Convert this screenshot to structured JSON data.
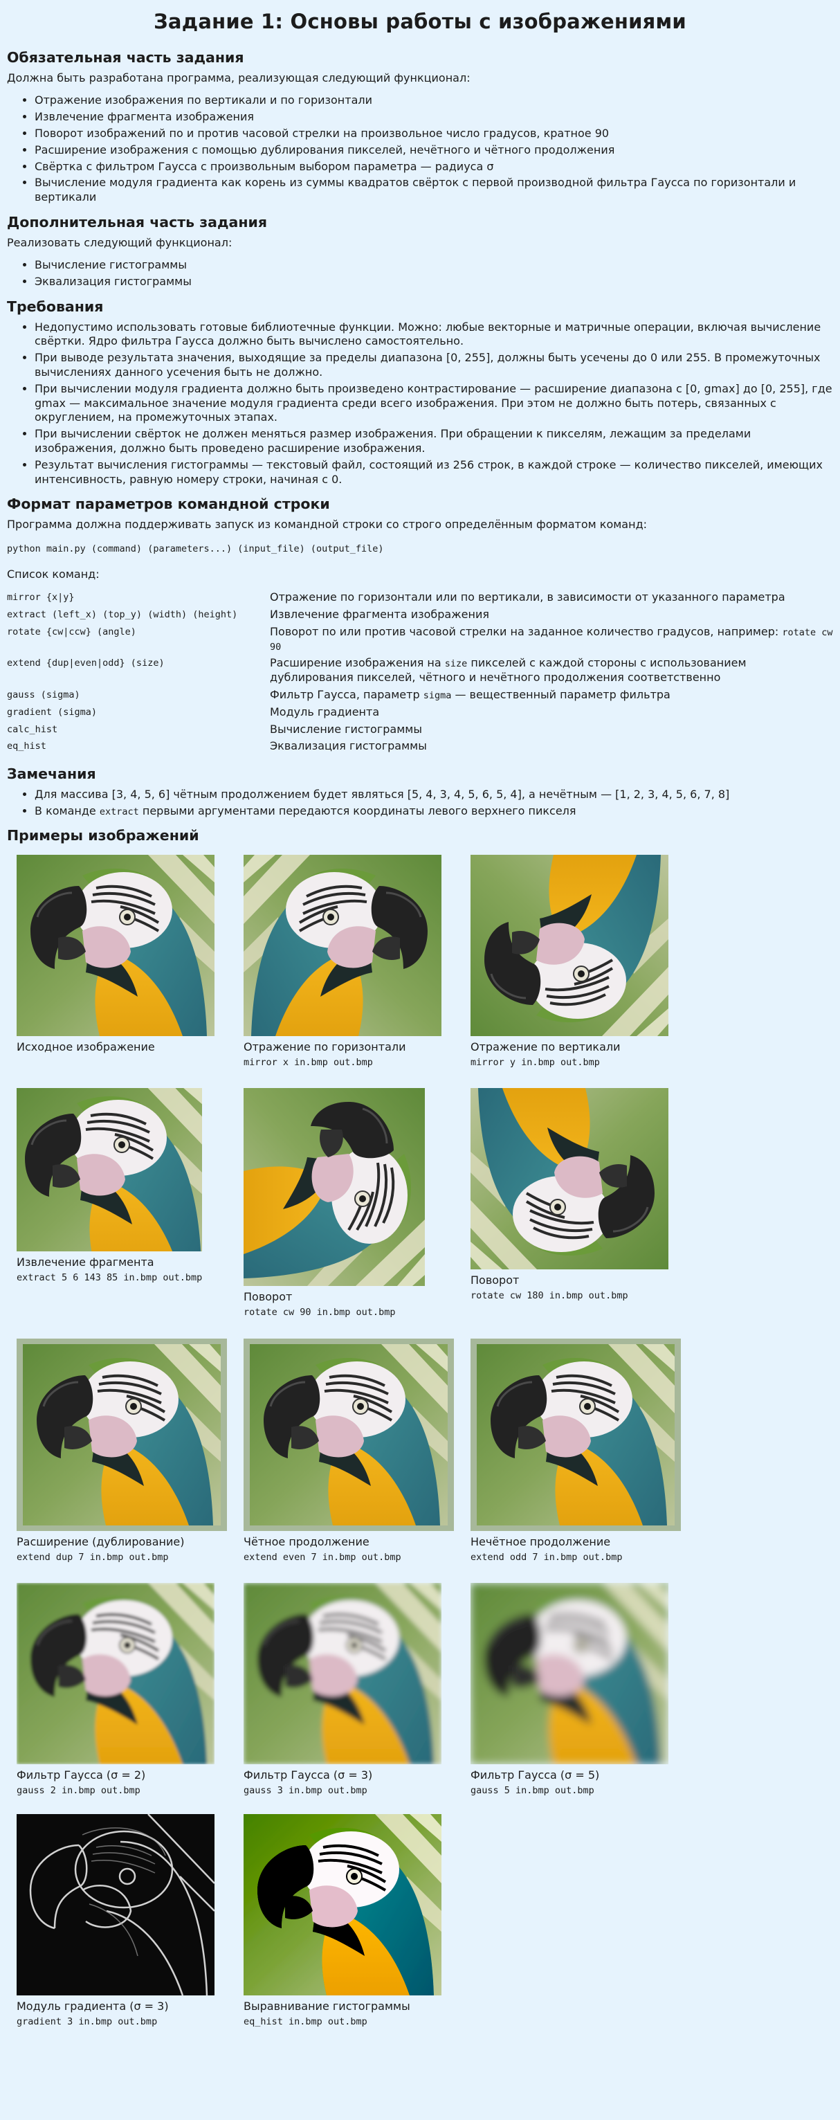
{
  "title": "Задание 1: Основы работы с изображениями",
  "mandatory": {
    "heading": "Обязательная часть задания",
    "intro": "Должна быть разработана программа, реализующая следующий функционал:",
    "items": [
      "Отражение изображения по вертикали и по горизонтали",
      "Извлечение фрагмента изображения",
      "Поворот изображений по и против часовой стрелки на произвольное число градусов, кратное 90",
      "Расширение изображения с помощью дублирования пикселей, нечётного и чётного продолжения",
      "Свёртка с фильтром Гаусса с произвольным выбором параметра — радиуса σ",
      "Вычисление модуля градиента как корень из суммы квадратов свёрток с первой производной фильтра Гаусса по горизонтали и вертикали"
    ]
  },
  "extra": {
    "heading": "Дополнительная часть задания",
    "intro": "Реализовать следующий функционал:",
    "items": [
      "Вычисление гистограммы",
      "Эквализация гистограммы"
    ]
  },
  "requirements": {
    "heading": "Требования",
    "items": [
      "Недопустимо использовать готовые библиотечные функции. Можно: любые векторные и матричные операции, включая вычисление свёртки. Ядро фильтра Гаусса должно быть вычислено самостоятельно.",
      "При выводе результата значения, выходящие за пределы диапазона [0, 255], должны быть усечены до 0 или 255. В промежуточных вычислениях данного усечения быть не должно.",
      "При вычислении модуля градиента должно быть произведено контрастирование — расширение диапазона с [0, gmax] до [0, 255], где gmax — максимальное значение модуля градиента среди всего изображения. При этом не должно быть потерь, связанных с округлением, на промежуточных этапах.",
      "При вычислении свёрток не должен меняться размер изображения. При обращении к пикселям, лежащим за пределами изображения, должно быть проведено расширение изображения.",
      "Результат вычисления гистограммы — текстовый файл, состоящий из 256 строк, в каждой строке — количество пикселей, имеющих интенсивность, равную номеру строки, начиная с 0."
    ]
  },
  "cli": {
    "heading": "Формат параметров командной строки",
    "intro": "Программа должна поддерживать запуск из командной строки со строго определённым форматом команд:",
    "usage": "python main.py (command) (parameters...) (input_file) (output_file)",
    "list_label": "Список команд:",
    "commands": [
      {
        "cmd": "mirror {x|y}",
        "desc": "Отражение по горизонтали или по вертикали, в зависимости от указанного параметра"
      },
      {
        "cmd": "extract (left_x) (top_y) (width) (height)",
        "desc": "Извлечение фрагмента изображения"
      },
      {
        "cmd": "rotate {cw|ccw} (angle)",
        "desc": "Поворот по или против часовой стрелки на заданное количество градусов, например:",
        "code": "rotate cw 90"
      },
      {
        "cmd": "extend {dup|even|odd} (size)",
        "desc_a": "Расширение изображения на",
        "code": "size",
        "desc_b": "пикселей с каждой стороны с использованием дублирования пикселей, чётного и нечётного продолжения соответственно"
      },
      {
        "cmd": "gauss (sigma)",
        "desc_a": "Фильтр Гаусса, параметр",
        "code": "sigma",
        "desc_b": "— вещественный параметр фильтра"
      },
      {
        "cmd": "gradient (sigma)",
        "desc": "Модуль градиента"
      },
      {
        "cmd": "calc_hist",
        "desc": "Вычисление гистограммы"
      },
      {
        "cmd": "eq_hist",
        "desc": "Эквализация гистограммы"
      }
    ]
  },
  "notes": {
    "heading": "Замечания",
    "item1": "Для массива [3, 4, 5, 6] чётным продолжением будет являться [5, 4, 3, 4, 5, 6, 5, 4], а нечётным — [1, 2, 3, 4, 5, 6, 7, 8]",
    "item2_a": "В команде",
    "item2_code": "extract",
    "item2_b": "первыми аргументами передаются координаты левого верхнего пикселя"
  },
  "examples": {
    "heading": "Примеры изображений",
    "items": [
      {
        "caption": "Исходное изображение",
        "command": ""
      },
      {
        "caption": "Отражение по горизонтали",
        "command": "mirror x in.bmp out.bmp"
      },
      {
        "caption": "Отражение по вертикали",
        "command": "mirror y in.bmp out.bmp"
      },
      {
        "caption": "Извлечение фрагмента",
        "command": "extract 5 6 143 85 in.bmp out.bmp"
      },
      {
        "caption": "Поворот",
        "command": "rotate cw 90 in.bmp out.bmp"
      },
      {
        "caption": "Поворот",
        "command": "rotate cw 180 in.bmp out.bmp"
      },
      {
        "caption": "Расширение (дублирование)",
        "command": "extend dup 7 in.bmp out.bmp"
      },
      {
        "caption": "Чётное продолжение",
        "command": "extend even 7 in.bmp out.bmp"
      },
      {
        "caption": "Нечётное продолжение",
        "command": "extend odd 7 in.bmp out.bmp"
      },
      {
        "caption": "Фильтр Гаусса (σ = 2)",
        "command": "gauss 2 in.bmp out.bmp"
      },
      {
        "caption": "Фильтр Гаусса (σ = 3)",
        "command": "gauss 3 in.bmp out.bmp"
      },
      {
        "caption": "Фильтр Гаусса (σ = 5)",
        "command": "gauss 5 in.bmp out.bmp"
      },
      {
        "caption": "Модуль градиента (σ = 3)",
        "command": "gradient 3 in.bmp out.bmp"
      },
      {
        "caption": "Выравнивание гистограммы",
        "command": "eq_hist in.bmp out.bmp"
      }
    ]
  }
}
